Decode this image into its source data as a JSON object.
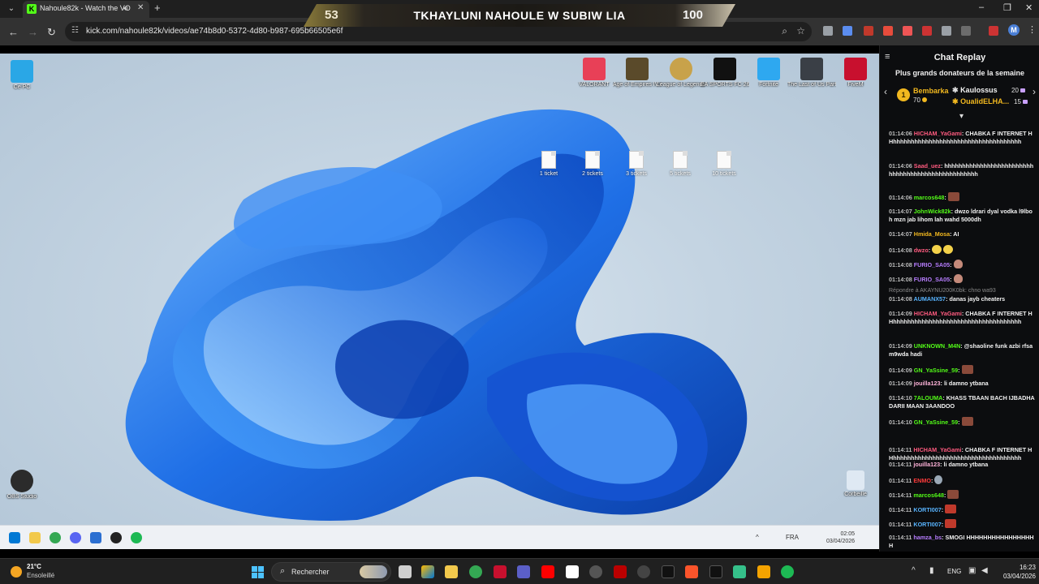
{
  "browser": {
    "tab_title": "Nahoule82k - Watch the VOD",
    "tab_favicon": "K",
    "url": "kick.com/nahoule82k/videos/ae74b8d0-5372-4d80-b987-695b66505e6f",
    "profile_initial": "M"
  },
  "overlay": {
    "score_left": "53",
    "title": "TKHAYLUNI NAHOULE W SUBIW LIA",
    "score_right": "100"
  },
  "desktop": {
    "left_icons": [
      {
        "label": "Ce PC",
        "color": "#2aa7e6"
      },
      {
        "label": "OBS Studio",
        "color": "#2b2b2b"
      }
    ],
    "top_icons": [
      {
        "label": "VALORANT",
        "color": "#e84057"
      },
      {
        "label": "Age of Empires IV Anniversa...",
        "color": "#5a4a2a"
      },
      {
        "label": "League of Legends",
        "color": "#c8a24a"
      },
      {
        "label": "EA SPORTS FC 26",
        "color": "#111111"
      },
      {
        "label": "Fortnite",
        "color": "#2ea8f0"
      },
      {
        "label": "The Last of Us Part II Remaste...",
        "color": "#3a3f46"
      },
      {
        "label": "FiveM",
        "color": "#c8102e"
      }
    ],
    "files": [
      "1 ticket",
      "2 tickets",
      "3 tickets",
      "5 tickets",
      "10 tickets"
    ],
    "recycle_bin": "Corbeille",
    "inner_taskbar": {
      "lang": "FRA",
      "time": "02:05",
      "date": "03/04/2026"
    }
  },
  "chat": {
    "title": "Chat Replay",
    "donors_title": "Plus grands donateurs de la semaine",
    "donors": [
      {
        "rank": "1",
        "name": "Bembarka",
        "amount": "70",
        "color": "#f2b81f"
      },
      {
        "name": "Kaulossus",
        "amount": "20",
        "color": "#f2f2f2"
      },
      {
        "name": "OualidELHA...",
        "amount": "15",
        "color": "#f2b81f"
      }
    ],
    "messages": [
      {
        "t": "01:14:06",
        "user": "HICHAM_YaGami",
        "color": "#ff5b7f",
        "text": "CHABKA F INTERNET HHhhhhhhhhhhhhhhhhhhhhhhhhhhhhhhhhhhhh",
        "emote": ""
      },
      {
        "t": "01:14:06",
        "user": "Saad_uez",
        "color": "#ff5b7f",
        "text": "hhhhhhhhhhhhhhhhhhhhhhhhhhhhhhhhhhhhhhhhhhhhhhhhhh",
        "emote": ""
      },
      {
        "t": "01:14:06",
        "user": "marcos648",
        "color": "#53fc18",
        "text": "",
        "emote": "b"
      },
      {
        "t": "01:14:07",
        "user": "JohnWick82k",
        "color": "#53fc18",
        "text": "dwzo ldrari dyal vodka l9lboh mzn jab lihom lah wahd 5000dh",
        "emote": ""
      },
      {
        "t": "01:14:07",
        "user": "Hmida_Mosa",
        "color": "#f2b81f",
        "text": "AI",
        "emote": ""
      },
      {
        "t": "01:14:08",
        "user": "dwzo",
        "color": "#ff5b7f",
        "text": "",
        "emote": "yy"
      },
      {
        "t": "01:14:08",
        "user": "FURIO_SA05",
        "color": "#b77dff",
        "text": "",
        "emote": "p"
      },
      {
        "t": "01:14:08",
        "user": "FURIO_SA05",
        "color": "#b77dff",
        "text": "",
        "emote": "p"
      },
      {
        "t": "01:14:08",
        "user": "AUMANX57",
        "color": "#58b4ff",
        "text": "danas jayb cheaters",
        "emote": "",
        "reply": "Répondre à AKAYNU200K0bk: chno wa93"
      },
      {
        "t": "01:14:09",
        "user": "HICHAM_YaGami",
        "color": "#ff5b7f",
        "text": "CHABKA F INTERNET HHhhhhhhhhhhhhhhhhhhhhhhhhhhhhhhhhhhhh",
        "emote": ""
      },
      {
        "t": "01:14:09",
        "user": "UNKNOWN_M4N",
        "color": "#53fc18",
        "text": "@shaoline funk azbi rfsa m9wda hadi",
        "emote": ""
      },
      {
        "t": "01:14:09",
        "user": "GN_YaSsine_59",
        "color": "#53fc18",
        "text": "",
        "emote": "b"
      },
      {
        "t": "01:14:09",
        "user": "jouilla123",
        "color": "#ffb3d9",
        "text": "li damno ytbana",
        "emote": ""
      },
      {
        "t": "01:14:10",
        "user": "7ALOUMA",
        "color": "#53fc18",
        "text": "KHASS TBAAN BACH IJBADHA DARII MAAN 3AANDOO",
        "emote": ""
      },
      {
        "t": "01:14:10",
        "user": "GN_YaSsine_59",
        "color": "#53fc18",
        "text": "",
        "emote": "b"
      },
      {
        "t": "01:14:11",
        "user": "HICHAM_YaGami",
        "color": "#ff5b7f",
        "text": "CHABKA F INTERNET HHhhhhhhhhhhhhhhhhhhhhhhhhhhhhhhhhhhhh",
        "emote": ""
      },
      {
        "t": "01:14:11",
        "user": "jouilla123",
        "color": "#ffb3d9",
        "text": "li damno ytbana",
        "emote": ""
      },
      {
        "t": "01:14:11",
        "user": "ENMO",
        "color": "#ff3b3b",
        "text": "",
        "emote": "g"
      },
      {
        "t": "01:14:11",
        "user": "marcos648",
        "color": "#53fc18",
        "text": "",
        "emote": "b"
      },
      {
        "t": "01:14:11",
        "user": "KORTI007",
        "color": "#58b4ff",
        "text": "",
        "emote": "r"
      },
      {
        "t": "01:14:11",
        "user": "KORTI007",
        "color": "#58b4ff",
        "text": "",
        "emote": "r"
      },
      {
        "t": "01:14:11",
        "user": "hamza_bs",
        "color": "#b77dff",
        "text": "SMOGI HHHHHHHHHHHHHHHHH",
        "emote": ""
      }
    ]
  },
  "host_taskbar": {
    "temp": "21°C",
    "weather": "Ensoleillé",
    "search_placeholder": "Rechercher",
    "lang": "ENG",
    "time": "16:23",
    "date": "03/04/2026"
  }
}
